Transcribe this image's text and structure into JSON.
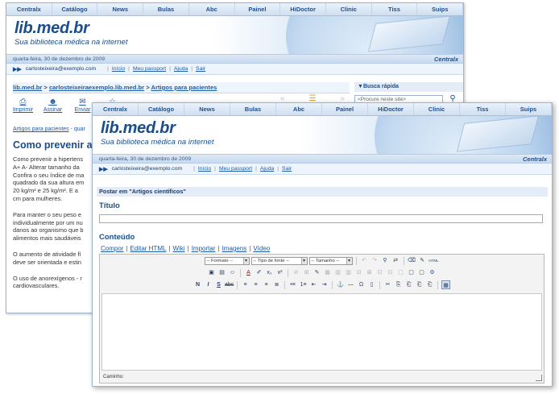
{
  "nav": [
    "Centralx",
    "Catálogo",
    "News",
    "Bulas",
    "Abc",
    "Painel",
    "HiDoctor",
    "Clinic",
    "Tiss",
    "Suips"
  ],
  "site": {
    "logo": "lib.med.br",
    "tagline": "Sua biblioteca médica na internet",
    "date": "quarta-feira, 30 de dezembro de 2009",
    "brand": "Centralx"
  },
  "user": {
    "arrows": "▶▶",
    "email": "carlosteixeira@exemplo.com",
    "links": [
      "Início",
      "Meu passport",
      "Ajuda",
      "Sair"
    ]
  },
  "back": {
    "breadcrumb": {
      "root": "lib.med.br",
      "sep1": " > ",
      "user": "carlosteixeiraexemplo.lib.med.br",
      "sep2": "  >  ",
      "section": "Artigos para pacientes"
    },
    "search": {
      "title": "Busca rápida",
      "placeholder": "<Procure neste site>"
    },
    "tools": [
      "Imprimir",
      "Assinar",
      "Enviar",
      ""
    ],
    "article": {
      "crumb": "Artigos para pacientes",
      "crumb_rest": " - quar",
      "title": "Como prevenir a h",
      "paragraphs": [
        [
          "Como prevenir a hipertens",
          "A+ A- Alterar tamanho da",
          "Confira o seu índice de ma",
          "quadrado da sua altura em",
          "20 kg/m² e 25 kg/m². E a",
          "cm para mulheres."
        ],
        [
          "Para manter o seu peso e",
          "individualmente por um nu",
          "danos ao organismo que b",
          "alimentos mais saudáveis"
        ],
        [
          "O aumento de atividade fí",
          "deve ser orientada e estin"
        ],
        [
          "O uso de anorexígenos - r",
          "cardiovasculares."
        ]
      ]
    }
  },
  "front": {
    "section": "Postar em \"Artigos científicos\"",
    "title_label": "Título",
    "content_label": "Conteúdo",
    "tabs": [
      "Compor",
      "Editar HTML",
      "Wiki",
      "Importar",
      "Imagens",
      "Vídeo"
    ],
    "editor": {
      "format": "-- Formato --",
      "font": "-- Tipo de fonte --",
      "size": "-- Tamanho --",
      "path_label": "Caminho:"
    }
  }
}
